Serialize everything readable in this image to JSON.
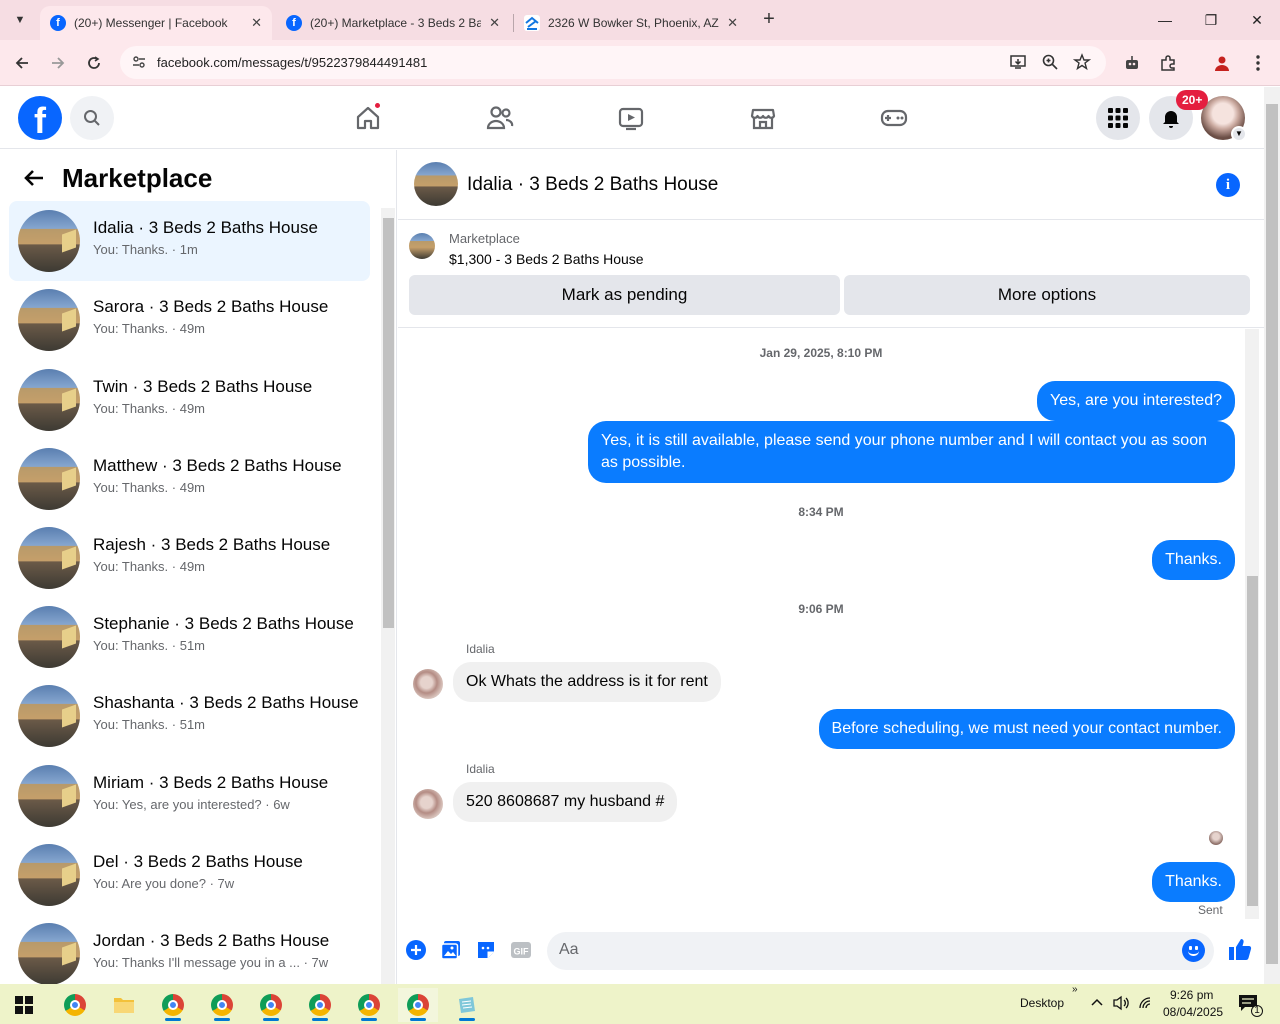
{
  "browser": {
    "tabs": [
      {
        "title": "(20+) Messenger | Facebook",
        "active": true
      },
      {
        "title": "(20+) Marketplace - 3 Beds 2 Ba",
        "active": false
      },
      {
        "title": "2326 W Bowker St, Phoenix, AZ",
        "active": false
      }
    ],
    "url": "facebook.com/messages/t/9522379844491481"
  },
  "header": {
    "notification_badge": "20+",
    "brand_color": "#0866ff"
  },
  "sidebar": {
    "title": "Marketplace",
    "conversations": [
      {
        "name": "Idalia · 3 Beds 2 Baths House",
        "preview": "You: Thanks. · 1m"
      },
      {
        "name": "Sarora · 3 Beds 2 Baths House",
        "preview": "You: Thanks. · 49m"
      },
      {
        "name": "Twin · 3 Beds 2 Baths House",
        "preview": "You: Thanks. · 49m"
      },
      {
        "name": "Matthew · 3 Beds 2 Baths House",
        "preview": "You: Thanks. · 49m"
      },
      {
        "name": "Rajesh · 3 Beds 2 Baths House",
        "preview": "You: Thanks. · 49m"
      },
      {
        "name": "Stephanie · 3 Beds 2 Baths House",
        "preview": "You: Thanks. · 51m"
      },
      {
        "name": "Shashanta · 3 Beds 2 Baths House",
        "preview": "You: Thanks. · 51m"
      },
      {
        "name": "Miriam · 3 Beds 2 Baths House",
        "preview": "You: Yes, are you interested? · 6w"
      },
      {
        "name": "Del · 3 Beds 2 Baths House",
        "preview": "You: Are you done? · 7w"
      },
      {
        "name": "Jordan · 3 Beds 2 Baths House",
        "preview": "You: Thanks I'll message you in a ...   · 7w"
      }
    ]
  },
  "chat": {
    "title": "Idalia · 3 Beds 2 Baths House",
    "listing": {
      "label": "Marketplace",
      "price_title": "$1,300 - 3 Beds 2 Baths House",
      "pending_button": "Mark as pending",
      "options_button": "More options"
    },
    "timestamps": [
      "Jan 29, 2025, 8:10 PM",
      "8:34 PM",
      "9:06 PM"
    ],
    "messages": {
      "out1": "Yes, are you interested?",
      "out2": "Yes, it is still available, please send your phone number and I will contact you as soon as possible.",
      "out3": "Thanks.",
      "in1_sender": "Idalia",
      "in1": "Ok Whats the address is it for rent",
      "out4": "Before scheduling, we must need your contact number.",
      "in2_sender": "Idalia",
      "in2": "520 8608687 my husband #",
      "out5": "Thanks.",
      "status": "Sent"
    },
    "composer_placeholder": "Aa",
    "bubble_color": "#0a7cff"
  },
  "taskbar": {
    "desktop_label": "Desktop",
    "time": "9:26 pm",
    "date": "08/04/2025",
    "notification_count": "1"
  }
}
